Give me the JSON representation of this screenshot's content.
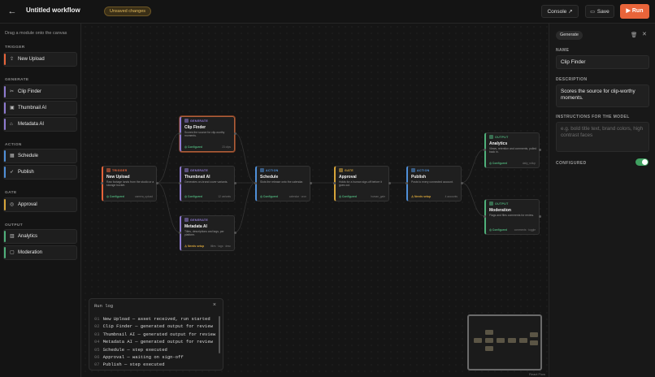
{
  "header": {
    "back_label": "←",
    "title": "Untitled workflow",
    "status_badge": "Unsaved changes",
    "console_label": "Console ↗",
    "save_label": "Save",
    "run_label": "▶ Run"
  },
  "sidebar": {
    "hint": "Drag a module onto the canvas",
    "sections": [
      {
        "title": "TRIGGER",
        "items": [
          {
            "label": "New Upload",
            "icon": "upload-icon",
            "glyph": "⇪"
          }
        ]
      },
      {
        "title": "GENERATE",
        "items": [
          {
            "label": "Clip Finder",
            "icon": "scissors-icon",
            "glyph": "✂"
          },
          {
            "label": "Thumbnail AI",
            "icon": "image-icon",
            "glyph": "▣"
          },
          {
            "label": "Metadata AI",
            "icon": "tag-icon",
            "glyph": "⌂"
          }
        ]
      },
      {
        "title": "ACTION",
        "items": [
          {
            "label": "Schedule",
            "icon": "calendar-icon",
            "glyph": "▦"
          },
          {
            "label": "Publish",
            "icon": "send-icon",
            "glyph": "➶"
          }
        ]
      },
      {
        "title": "GATE",
        "items": [
          {
            "label": "Approval",
            "icon": "check-circle-icon",
            "glyph": "◎"
          }
        ]
      },
      {
        "title": "OUTPUT",
        "items": [
          {
            "label": "Analytics",
            "icon": "bar-chart-icon",
            "glyph": "▥"
          },
          {
            "label": "Moderation",
            "icon": "message-icon",
            "glyph": "▢"
          }
        ]
      }
    ]
  },
  "colors": {
    "trigger": "#e8643a",
    "generate": "#8e7ad0",
    "action": "#4f8fd8",
    "gate": "#d6a43a",
    "output": "#4fb07a",
    "configured": "#4fb07a",
    "needs_setup": "#d6a43a",
    "accent": "#e8643a"
  },
  "nodes": [
    {
      "id": "clip",
      "type": "GENERATE",
      "name": "Clip Finder",
      "desc": "Scores the source for clip-worthy moments.",
      "status": "◎ Configured",
      "meta": "23 clips",
      "kind": "generate"
    },
    {
      "id": "upload",
      "type": "TRIGGER",
      "name": "New Upload",
      "desc": "Raw footage lands from the studio or a storage bucket.",
      "status": "◎ Configured",
      "meta": "camera_upload",
      "kind": "trigger"
    },
    {
      "id": "thumb",
      "type": "GENERATE",
      "name": "Thumbnail AI",
      "desc": "Generates on-brand cover variants.",
      "status": "◎ Configured",
      "meta": "12 variants",
      "kind": "generate"
    },
    {
      "id": "sched",
      "type": "ACTION",
      "name": "Schedule",
      "desc": "Slots the release onto the calendar.",
      "status": "◎ Configured",
      "meta": "calendar · cron",
      "kind": "action"
    },
    {
      "id": "appr",
      "type": "GATE",
      "name": "Approval",
      "desc": "Holds for a human sign-off before it goes out.",
      "status": "◎ Configured",
      "meta": "human_gate",
      "kind": "gate"
    },
    {
      "id": "pub",
      "type": "ACTION",
      "name": "Publish",
      "desc": "Posts to every connected account.",
      "status": "⚠ Needs setup",
      "meta": "4 accounts",
      "kind": "action"
    },
    {
      "id": "meta",
      "type": "GENERATE",
      "name": "Metadata AI",
      "desc": "Titles, descriptions and tags, per platform.",
      "status": "⚠ Needs setup",
      "meta": "titles · tags · desc",
      "kind": "generate",
      "warn": true
    },
    {
      "id": "anal",
      "type": "OUTPUT",
      "name": "Analytics",
      "desc": "Views, retention and comments, pulled back in.",
      "status": "◎ Configured",
      "meta": "daily_rollup",
      "kind": "output"
    },
    {
      "id": "mod",
      "type": "OUTPUT",
      "name": "Moderation",
      "desc": "Flags and files comments for review.",
      "status": "◎ Configured",
      "meta": "comments · toggle",
      "kind": "output"
    }
  ],
  "runlog": {
    "title": "Run log",
    "close": "×",
    "lines": [
      {
        "n": "01",
        "text": "New Upload — asset received, run started"
      },
      {
        "n": "02",
        "text": "Clip Finder — generated output for review"
      },
      {
        "n": "03",
        "text": "Thumbnail AI — generated output for review"
      },
      {
        "n": "04",
        "text": "Metadata AI — generated output for review"
      },
      {
        "n": "05",
        "text": "Schedule — step executed"
      },
      {
        "n": "06",
        "text": "Approval — waiting on sign-off"
      },
      {
        "n": "07",
        "text": "Publish — step executed"
      }
    ]
  },
  "minimap": {
    "attribution": "React Flow"
  },
  "inspector": {
    "badge": "Generate",
    "name_label": "NAME",
    "name_value": "Clip Finder",
    "desc_label": "DESCRIPTION",
    "desc_value": "Scores the source for clip-worthy moments.",
    "instr_label": "INSTRUCTIONS FOR THE MODEL",
    "instr_placeholder": "e.g. bold title text, brand colors, high contrast faces",
    "configured_label": "CONFIGURED",
    "configured_on": true
  }
}
